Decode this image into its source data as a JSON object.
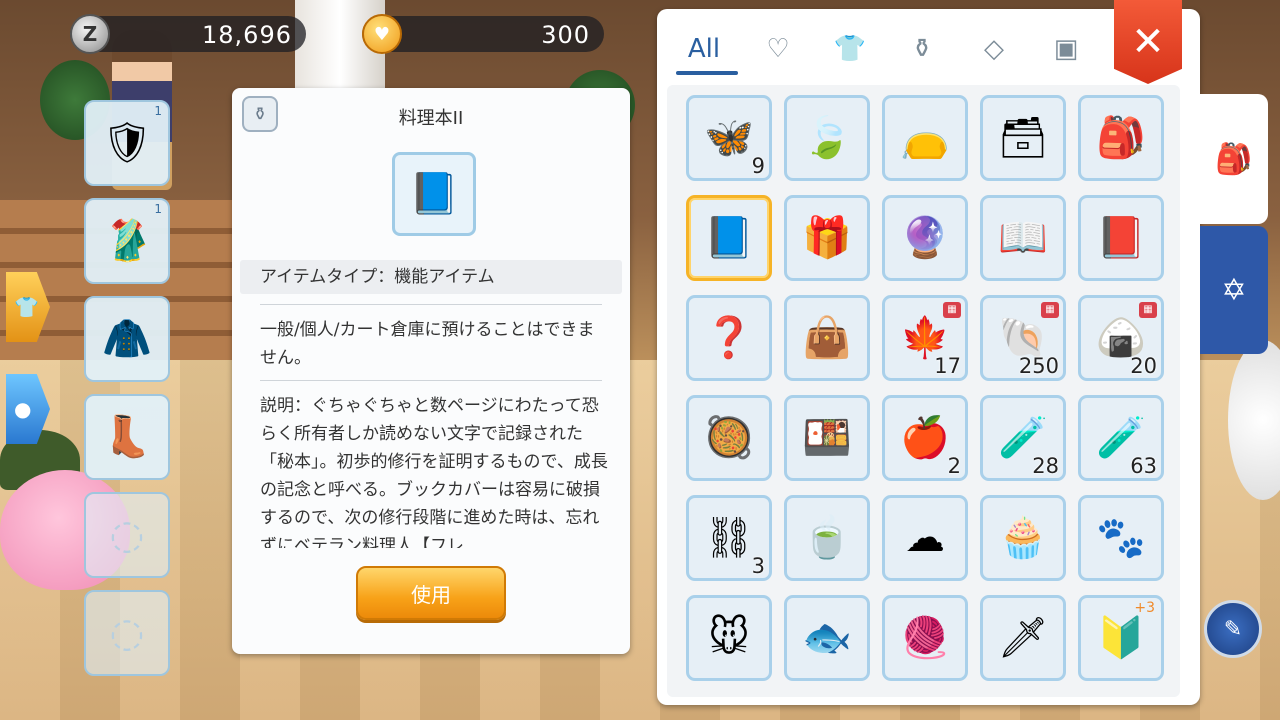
{
  "currency": {
    "zeny_icon": "zeny-coin-icon",
    "zeny_value": "18,696",
    "cat_icon": "cat-coin-icon",
    "cat_value": "300"
  },
  "equipment": [
    {
      "icon": "armor-icon",
      "glyph": "🛡",
      "count": "1"
    },
    {
      "icon": "robe-icon",
      "glyph": "🥻",
      "count": "1"
    },
    {
      "icon": "cape-icon",
      "glyph": "🧥",
      "count": ""
    },
    {
      "icon": "boots-icon",
      "glyph": "👢",
      "count": ""
    },
    {
      "icon": "empty-slot-icon",
      "glyph": "◌",
      "count": ""
    },
    {
      "icon": "empty-slot-icon",
      "glyph": "◌",
      "count": ""
    }
  ],
  "detail": {
    "badge_icon": "jar-icon",
    "title": "料理本II",
    "item_icon": "cookbook-icon",
    "type_text": "アイテムタイプ：機能アイテム",
    "note_text": "一般/個人/カート倉庫に預けることはできません。",
    "description": "説明：ぐちゃぐちゃと数ページにわたって恐らく所有者しか読めない文字で記録された「秘本」。初歩的修行を証明するもので、成長の記念と呼べる。ブックカバーは容易に破損するので、次の修行段階に進めた時は、忘れずにベテラン料理人【フレ",
    "use_label": "使用"
  },
  "inventory": {
    "tabs": [
      {
        "label": "All",
        "icon": ""
      },
      {
        "label": "",
        "icon": "heart-icon",
        "glyph": "♡"
      },
      {
        "label": "",
        "icon": "shirt-icon",
        "glyph": "👕"
      },
      {
        "label": "",
        "icon": "potion-icon",
        "glyph": "⚱"
      },
      {
        "label": "",
        "icon": "gem-icon",
        "glyph": "◇"
      },
      {
        "label": "",
        "icon": "card-icon",
        "glyph": "▣"
      }
    ],
    "items": [
      {
        "icon": "butterfly-wing-icon",
        "glyph": "🦋",
        "qty": "9"
      },
      {
        "icon": "leaf-icon",
        "glyph": "🍃",
        "qty": ""
      },
      {
        "icon": "pouch-icon",
        "glyph": "👝",
        "qty": ""
      },
      {
        "icon": "card-box-icon",
        "glyph": "🗃",
        "qty": ""
      },
      {
        "icon": "backpack-icon",
        "glyph": "🎒",
        "qty": ""
      },
      {
        "icon": "cookbook-icon",
        "glyph": "📘",
        "qty": "",
        "selected": true
      },
      {
        "icon": "gift-box-icon",
        "glyph": "🎁",
        "qty": ""
      },
      {
        "icon": "mirror-icon",
        "glyph": "🔮",
        "qty": ""
      },
      {
        "icon": "open-book-icon",
        "glyph": "📖",
        "qty": ""
      },
      {
        "icon": "journal-icon",
        "glyph": "📕",
        "qty": ""
      },
      {
        "icon": "mystery-box-icon",
        "glyph": "❓",
        "qty": ""
      },
      {
        "icon": "satchel-icon",
        "glyph": "👜",
        "qty": ""
      },
      {
        "icon": "maple-coin-icon",
        "glyph": "🍁",
        "qty": "17",
        "shop": true
      },
      {
        "icon": "shell-icon",
        "glyph": "🐚",
        "qty": "250",
        "shop": true
      },
      {
        "icon": "rice-ball-icon",
        "glyph": "🍙",
        "qty": "20",
        "shop": true
      },
      {
        "icon": "food-tray-icon",
        "glyph": "🥘",
        "qty": ""
      },
      {
        "icon": "food-tray-icon",
        "glyph": "🍱",
        "qty": ""
      },
      {
        "icon": "apple-drink-icon",
        "glyph": "🍎",
        "qty": "2"
      },
      {
        "icon": "purple-potion-icon",
        "glyph": "🧪",
        "qty": "28"
      },
      {
        "icon": "red-potion-icon",
        "glyph": "🧪",
        "qty": "63"
      },
      {
        "icon": "chain-icon",
        "glyph": "⛓",
        "qty": "3"
      },
      {
        "icon": "tea-cup-icon",
        "glyph": "🍵",
        "qty": ""
      },
      {
        "icon": "cotton-candy-icon",
        "glyph": "☁",
        "qty": ""
      },
      {
        "icon": "cupcake-icon",
        "glyph": "🧁",
        "qty": ""
      },
      {
        "icon": "paw-icon",
        "glyph": "🐾",
        "qty": ""
      },
      {
        "icon": "toy-mouse-icon",
        "glyph": "🐭",
        "qty": ""
      },
      {
        "icon": "fish-cake-icon",
        "glyph": "🐟",
        "qty": ""
      },
      {
        "icon": "yarn-ball-icon",
        "glyph": "🧶",
        "qty": ""
      },
      {
        "icon": "sword-icon",
        "glyph": "🗡",
        "qty": ""
      },
      {
        "icon": "shield-icon",
        "glyph": "🔰",
        "qty": "",
        "plus": "+3"
      }
    ]
  },
  "close_icon": "close-icon",
  "side_tabs": [
    {
      "icon": "backpack-icon",
      "glyph": "🎒"
    },
    {
      "icon": "magic-circle-icon",
      "glyph": "✡"
    }
  ],
  "round_button_icon": "edit-icon"
}
